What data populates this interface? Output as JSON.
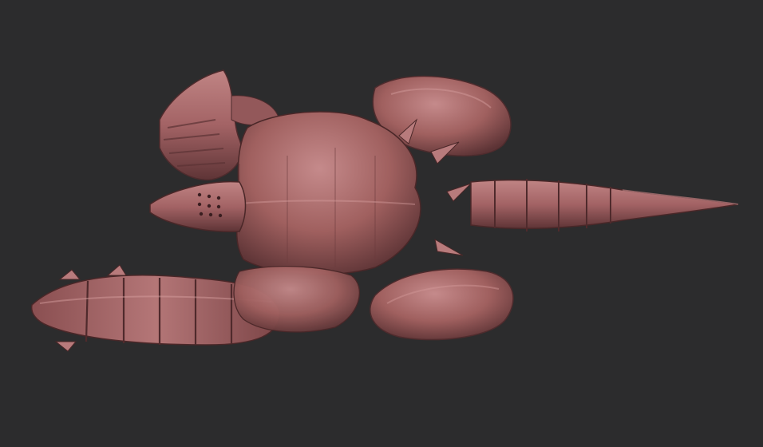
{
  "viewport": {
    "background_color": "#2c2c2d",
    "subject": "creature-sculpt",
    "material_color": "#a8676a",
    "material_shadow": "#5a3234",
    "material_highlight": "#c98c8c"
  }
}
